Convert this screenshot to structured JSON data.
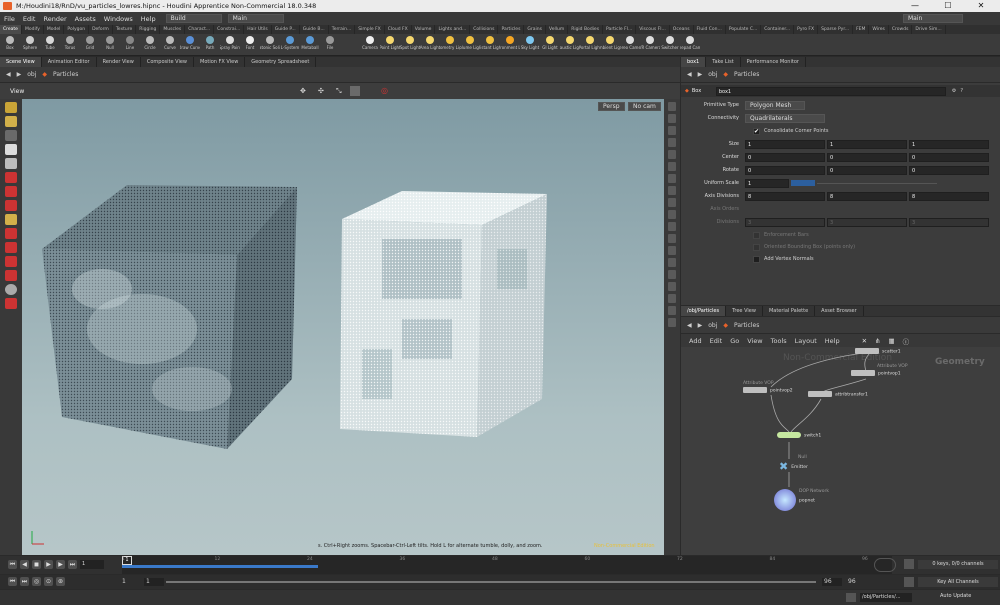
{
  "window": {
    "title": "M:/Houdini18/RnD/vu_particles_lowres.hipnc - Houdini Apprentice Non-Commercial 18.0.348",
    "minimize": "—",
    "maximize": "☐",
    "close": "✕"
  },
  "menubar": {
    "items": [
      "File",
      "Edit",
      "Render",
      "Assets",
      "Windows",
      "Help"
    ],
    "desktop_label": "Build",
    "desktop2_label": "Main",
    "right_label": "Main"
  },
  "shelf": {
    "tabs": [
      "Create",
      "Modify",
      "Model",
      "Polygon",
      "Deform",
      "Texture",
      "Rigging",
      "Muscles",
      "Charact...",
      "Constrai...",
      "Hair Utils",
      "Guide P...",
      "Guide B...",
      "Terrain...",
      "Simple FX",
      "Cloud FX",
      "Volume",
      "Lights and...",
      "Collisions",
      "Particles",
      "Grains",
      "Vellum",
      "Rigid Bodies",
      "Particle Fl...",
      "Viscous Fl...",
      "Oceans",
      "Fluid Con...",
      "Populate C...",
      "Container...",
      "Pyro FX",
      "Sparse Pyr...",
      "FEM",
      "Wires",
      "Crowds",
      "Drive Sim..."
    ],
    "left_tools": [
      "Box",
      "Sphere",
      "Tube",
      "Torus",
      "Grid",
      "Null",
      "Line",
      "Circle",
      "Curve",
      "Draw Curve",
      "Path",
      "Spray Paint",
      "Font",
      "Platonic Solids",
      "L-System",
      "Metaball",
      "File"
    ],
    "right_tools": [
      "Camera",
      "Point Light",
      "Spot Light",
      "Area Light",
      "Geometry Light",
      "Volume Light",
      "Distant Light",
      "Environment Light",
      "Sky Light",
      "GI Light",
      "Caustic Light",
      "Portal Light",
      "Ambient Light",
      "Stereo Camera",
      "VR Camera",
      "Switcher",
      "Gamepad Camera"
    ]
  },
  "left_pane": {
    "tabs": [
      "Scene View",
      "Animation Editor",
      "Render View",
      "Composite View",
      "Motion FX View",
      "Geometry Spreadsheet"
    ],
    "path_obj": "obj",
    "path_node": "Particles",
    "view_label": "View",
    "persp": "Persp",
    "nocam": "No cam",
    "hint": "s. Ctrl+Right zooms. Spacebar-Ctrl-Left tilts. Hold L for alternate tumble, dolly, and zoom.",
    "watermark": "Non-Commercial Edition"
  },
  "params": {
    "tabs": [
      "box1",
      "Take List",
      "Performance Monitor"
    ],
    "path_obj": "obj",
    "path_node": "Particles",
    "node_type": "Box",
    "node_name": "box1",
    "primitive_type": {
      "label": "Primitive Type",
      "value": "Polygon Mesh"
    },
    "connectivity": {
      "label": "Connectivity",
      "value": "Quadrilaterals"
    },
    "consolidate": {
      "label": "Consolidate Corner Points",
      "checked": "✔"
    },
    "size": {
      "label": "Size",
      "values": [
        "1",
        "1",
        "1"
      ]
    },
    "center": {
      "label": "Center",
      "values": [
        "0",
        "0",
        "0"
      ]
    },
    "rotate": {
      "label": "Rotate",
      "values": [
        "0",
        "0",
        "0"
      ]
    },
    "uniform_scale": {
      "label": "Uniform Scale",
      "value": "1"
    },
    "axis_divisions": {
      "label": "Axis Divisions",
      "values": [
        "8",
        "8",
        "8"
      ]
    },
    "axis_orders": {
      "label": "Axis Orders"
    },
    "divisions": {
      "label": "Divisions",
      "values": [
        "3",
        "3",
        "3"
      ]
    },
    "enforcement_bars": "Enforcement Bars",
    "oriented_bbox": "Oriented Bounding Box (points only)",
    "add_vertex_normals": "Add Vertex Normals"
  },
  "network": {
    "tabs": [
      "/obj/Particles",
      "Tree View",
      "Material Palette",
      "Asset Browser"
    ],
    "path_obj": "obj",
    "path_node": "Particles",
    "menu": [
      "Add",
      "Edit",
      "Go",
      "View",
      "Tools",
      "Layout",
      "Help"
    ],
    "watermark": "Non-Commercial Edition",
    "context": "Geometry",
    "nodes": {
      "scatter": "scatter1",
      "pointvop1_sub": "Attribute VOP",
      "pointvop1": "pointvop1",
      "pointvop2_sub": "Attribute VOP",
      "pointvop2": "pointvop2",
      "attribtransfer": "attribtransfer1",
      "switch": "switch1",
      "emitter_sub": "Null",
      "emitter": "Emitter",
      "popnet_sub": "DOP Network",
      "popnet": "popnet"
    }
  },
  "timeline": {
    "ticks": [
      "1",
      "12",
      "24",
      "36",
      "48",
      "60",
      "72",
      "84",
      "96"
    ],
    "frame": "1",
    "keys": "0 keys, 0/0 channels",
    "key_all": "Key All Channels"
  },
  "range": {
    "start": "1",
    "start2": "1",
    "end": "96",
    "end2": "96"
  },
  "statusbar": {
    "path": "/obj/Particles/...",
    "auto_update": "Auto Update"
  },
  "colors": {
    "accent": "#e8622a",
    "timeline_blue": "#3a79c9",
    "viewport_top": "#7f9aa3",
    "viewport_bottom": "#b6c6c8"
  }
}
